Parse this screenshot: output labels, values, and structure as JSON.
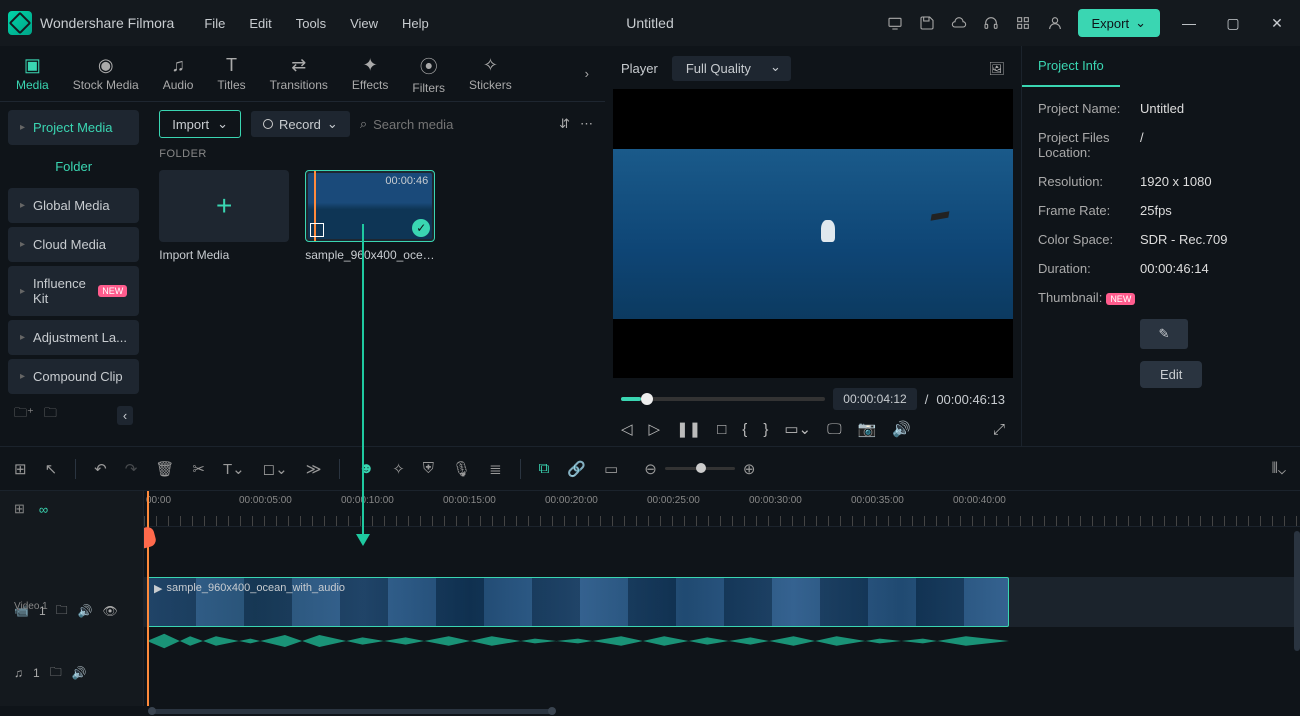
{
  "app": {
    "name": "Wondershare Filmora",
    "doc_title": "Untitled"
  },
  "menu": [
    "File",
    "Edit",
    "Tools",
    "View",
    "Help"
  ],
  "export_label": "Export",
  "tool_tabs": [
    {
      "label": "Media",
      "active": true
    },
    {
      "label": "Stock Media"
    },
    {
      "label": "Audio"
    },
    {
      "label": "Titles"
    },
    {
      "label": "Transitions"
    },
    {
      "label": "Effects"
    },
    {
      "label": "Filters"
    },
    {
      "label": "Stickers"
    }
  ],
  "sidebar": {
    "project_media": "Project Media",
    "folder": "Folder",
    "items": [
      {
        "label": "Global Media"
      },
      {
        "label": "Cloud Media"
      },
      {
        "label": "Influence Kit",
        "badge": "NEW"
      },
      {
        "label": "Adjustment La..."
      },
      {
        "label": "Compound Clip"
      }
    ]
  },
  "media_toolbar": {
    "import": "Import",
    "record": "Record",
    "search_placeholder": "Search media"
  },
  "folder_hdr": "FOLDER",
  "thumbs": {
    "import_media": "Import Media",
    "clip_duration": "00:00:46",
    "clip_name": "sample_960x400_ocea..."
  },
  "player": {
    "tab": "Player",
    "quality": "Full Quality",
    "time_cur": "00:00:04:12",
    "time_sep": "/",
    "time_total": "00:00:46:13"
  },
  "project_info": {
    "tab": "Project Info",
    "rows": [
      {
        "k": "Project Name:",
        "v": "Untitled"
      },
      {
        "k": "Project Files Location:",
        "v": "/"
      },
      {
        "k": "Resolution:",
        "v": "1920 x 1080"
      },
      {
        "k": "Frame Rate:",
        "v": "25fps"
      },
      {
        "k": "Color Space:",
        "v": "SDR - Rec.709"
      },
      {
        "k": "Duration:",
        "v": "00:00:46:14"
      }
    ],
    "thumbnail_k": "Thumbnail:",
    "thumbnail_badge": "NEW",
    "edit": "Edit"
  },
  "timeline": {
    "marks": [
      "00:00",
      "00:00:05:00",
      "00:00:10:00",
      "00:00:15:00",
      "00:00:20:00",
      "00:00:25:00",
      "00:00:30:00",
      "00:00:35:00",
      "00:00:40:00"
    ],
    "clip_name": "sample_960x400_ocean_with_audio",
    "video_idx": "1",
    "video_label": "Video 1",
    "audio_idx": "1"
  }
}
